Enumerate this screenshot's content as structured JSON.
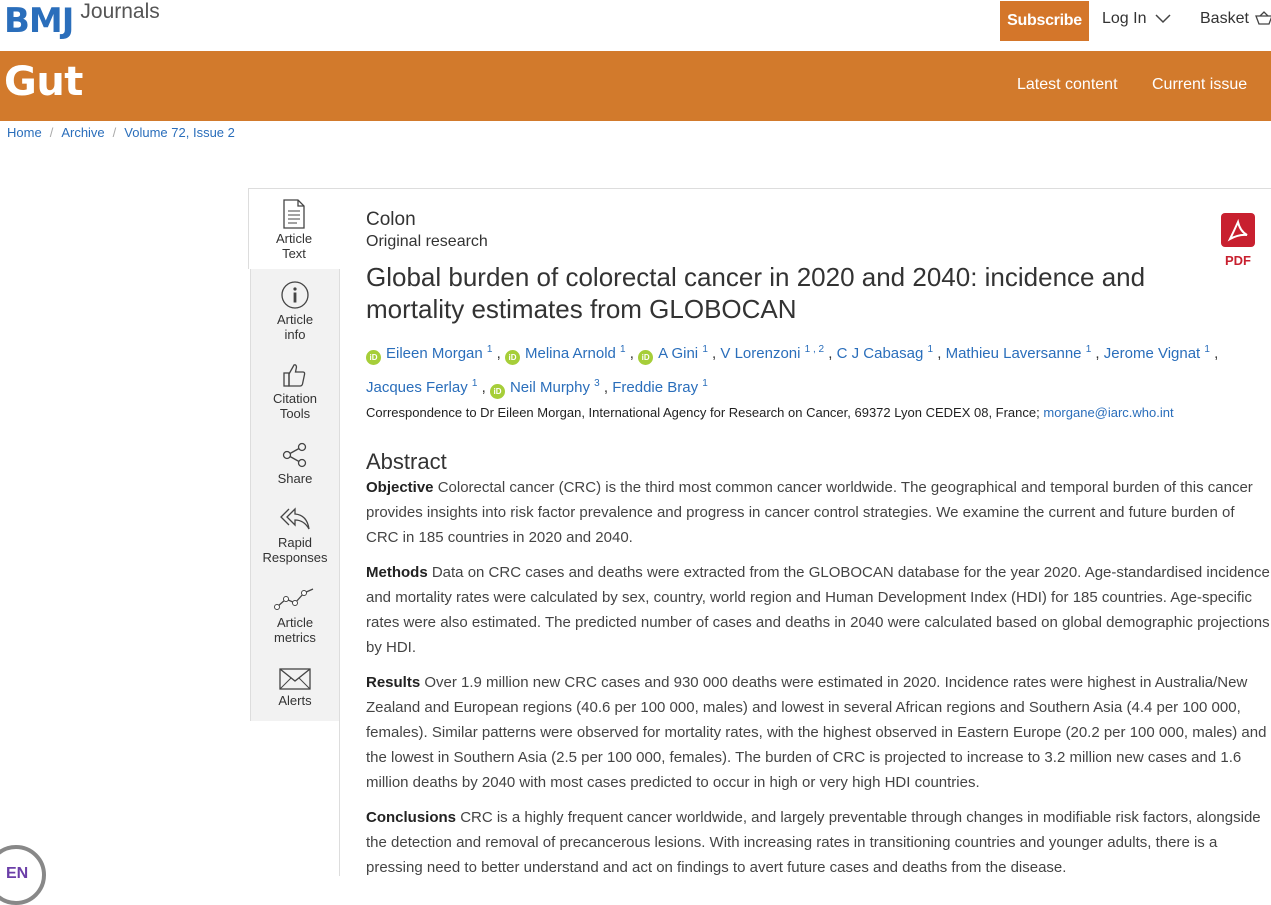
{
  "header": {
    "brand": "BMJ",
    "brand_suffix": "Journals",
    "subscribe_label": "Subscribe",
    "login_label": "Log In",
    "basket_label": "Basket"
  },
  "journal": {
    "title": "Gut",
    "nav": [
      "Latest content",
      "Current issue"
    ]
  },
  "breadcrumb": [
    "Home",
    "Archive",
    "Volume 72, Issue 2"
  ],
  "tools": [
    {
      "label1": "Article",
      "label2": "Text",
      "icon": "document-icon"
    },
    {
      "label1": "Article",
      "label2": "info",
      "icon": "info-icon"
    },
    {
      "label1": "Citation",
      "label2": "Tools",
      "icon": "thumbs-up-icon"
    },
    {
      "label1": "Share",
      "label2": "",
      "icon": "share-icon"
    },
    {
      "label1": "Rapid",
      "label2": "Responses",
      "icon": "reply-all-icon"
    },
    {
      "label1": "Article",
      "label2": "metrics",
      "icon": "line-chart-icon"
    },
    {
      "label1": "Alerts",
      "label2": "",
      "icon": "envelope-icon"
    }
  ],
  "article": {
    "section": "Colon",
    "type": "Original research",
    "title": "Global burden of colorectal cancer in 2020 and 2040: incidence and mortality estimates from GLOBOCAN",
    "authors": [
      {
        "name": "Eileen Morgan",
        "aff": "1"
      },
      {
        "name": "Melina Arnold",
        "aff": "1"
      },
      {
        "name": "A Gini",
        "aff": "1"
      },
      {
        "name": "V Lorenzoni",
        "aff": "1 , 2"
      },
      {
        "name": "C J Cabasag",
        "aff": "1"
      },
      {
        "name": "Mathieu Laversanne",
        "aff": "1"
      },
      {
        "name": "Jerome Vignat",
        "aff": "1"
      },
      {
        "name": "Jacques Ferlay",
        "aff": "1"
      },
      {
        "name": "Neil Murphy",
        "aff": "3"
      },
      {
        "name": "Freddie Bray",
        "aff": "1"
      }
    ],
    "orcid_badge": "iD",
    "correspondence": "Correspondence to Dr Eileen Morgan, International Agency for Research on Cancer, 69372 Lyon CEDEX 08, France;",
    "email": "morgane@iarc.who.int",
    "pdf_label": "PDF"
  },
  "abstract": {
    "heading": "Abstract",
    "sections": [
      {
        "label": "Objective",
        "text": "Colorectal cancer (CRC) is the third most common cancer worldwide. The geographical and temporal burden of this cancer provides insights into risk factor prevalence and progress in cancer control strategies. We examine the current and future burden of CRC in 185 countries in 2020 and 2040."
      },
      {
        "label": "Methods",
        "text": "Data on CRC cases and deaths were extracted from the GLOBOCAN database for the year 2020. Age-standardised incidence and mortality rates were calculated by sex, country, world region and Human Development Index (HDI) for 185 countries. Age-specific rates were also estimated. The predicted number of cases and deaths in 2040 were calculated based on global demographic projections by HDI."
      },
      {
        "label": "Results",
        "text": "Over 1.9 million new CRC cases and 930 000 deaths were estimated in 2020. Incidence rates were highest in Australia/New Zealand and European regions (40.6 per 100 000, males) and lowest in several African regions and Southern Asia (4.4 per 100 000, females). Similar patterns were observed for mortality rates, with the highest observed in Eastern Europe (20.2 per 100 000, males) and the lowest in Southern Asia (2.5 per 100 000, females). The burden of CRC is projected to increase to 3.2 million new cases and 1.6 million deaths by 2040 with most cases predicted to occur in high or very high HDI countries."
      },
      {
        "label": "Conclusions",
        "text": "CRC is a highly frequent cancer worldwide, and largely preventable through changes in modifiable risk factors, alongside the detection and removal of precancerous lesions. With increasing rates in transitioning countries and younger adults, there is a pressing need to better understand and act on findings to avert future cases and deaths from the disease."
      }
    ]
  },
  "language_badge": "EN",
  "colors": {
    "brand_blue": "#2a6ebb",
    "band_orange": "#d27a2c",
    "subscribe_orange": "#d4762a",
    "pdf_red": "#c8202f",
    "orcid_green": "#a6ce39"
  }
}
